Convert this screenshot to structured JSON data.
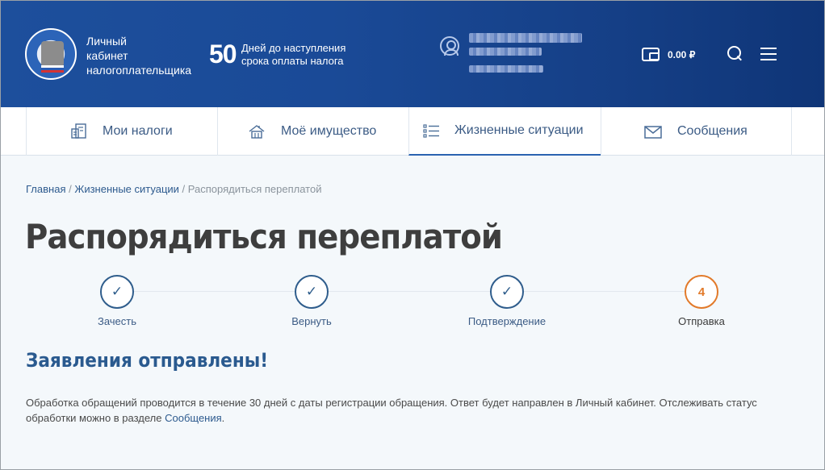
{
  "header": {
    "brand_line1": "Личный",
    "brand_line2": "кабинет",
    "brand_line3": "налогоплательщика",
    "days_count": "50",
    "days_line1": "Дней до наступления",
    "days_line2": "срока оплаты налога",
    "balance": "0.00 ₽"
  },
  "nav": {
    "items": [
      {
        "label": "Мои налоги",
        "icon": "taxes-icon"
      },
      {
        "label": "Моё имущество",
        "icon": "property-icon"
      },
      {
        "label": "Жизненные ситуации",
        "icon": "list-icon",
        "active": true
      },
      {
        "label": "Сообщения",
        "icon": "envelope-icon"
      }
    ]
  },
  "breadcrumbs": {
    "home": "Главная",
    "sep1": " / ",
    "section": "Жизненные ситуации",
    "sep2": " / ",
    "current": "Распорядиться переплатой"
  },
  "page_title": "Распорядиться переплатой",
  "steps": [
    {
      "label": "Зачесть",
      "state": "done",
      "mark": "✓"
    },
    {
      "label": "Вернуть",
      "state": "done",
      "mark": "✓"
    },
    {
      "label": "Подтверждение",
      "state": "done",
      "mark": "✓"
    },
    {
      "label": "Отправка",
      "state": "current",
      "mark": "4"
    }
  ],
  "result": {
    "title": "Заявления отправлены!",
    "text_part1": "Обработка обращений проводится в течение 30 дней с даты регистрации обращения. Ответ будет направлен в  Личный кабинет. Отслеживать статус обработки можно в разделе ",
    "link": "Сообщения",
    "text_part2": "."
  },
  "colors": {
    "header_bg": "#1a4a97",
    "accent": "#2a63b0",
    "current_step": "#e27a2a",
    "done_step": "#2f5d8c"
  }
}
